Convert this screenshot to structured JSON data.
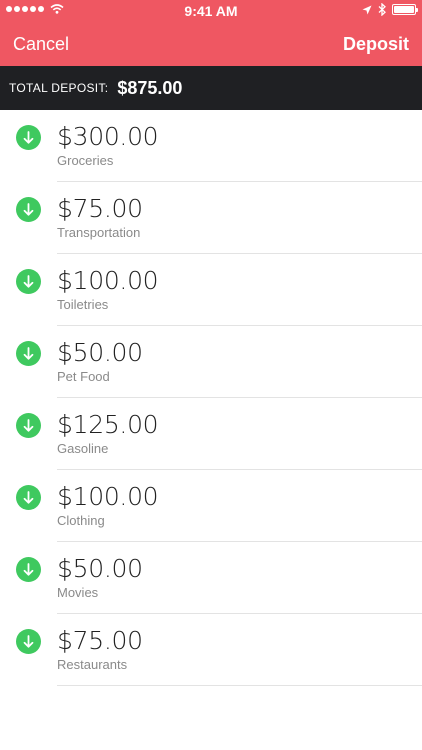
{
  "status": {
    "time": "9:41 AM"
  },
  "nav": {
    "cancel_label": "Cancel",
    "deposit_label": "Deposit"
  },
  "summary": {
    "label": "TOTAL DEPOSIT:",
    "amount": "$875.00"
  },
  "colors": {
    "header": "#ef5762",
    "bar": "#1f2023",
    "icon": "#3fc95f"
  },
  "items": [
    {
      "amount": "$300.00",
      "category": "Groceries"
    },
    {
      "amount": "$75.00",
      "category": "Transportation"
    },
    {
      "amount": "$100.00",
      "category": "Toiletries"
    },
    {
      "amount": "$50.00",
      "category": "Pet Food"
    },
    {
      "amount": "$125.00",
      "category": "Gasoline"
    },
    {
      "amount": "$100.00",
      "category": "Clothing"
    },
    {
      "amount": "$50.00",
      "category": "Movies"
    },
    {
      "amount": "$75.00",
      "category": "Restaurants"
    }
  ]
}
